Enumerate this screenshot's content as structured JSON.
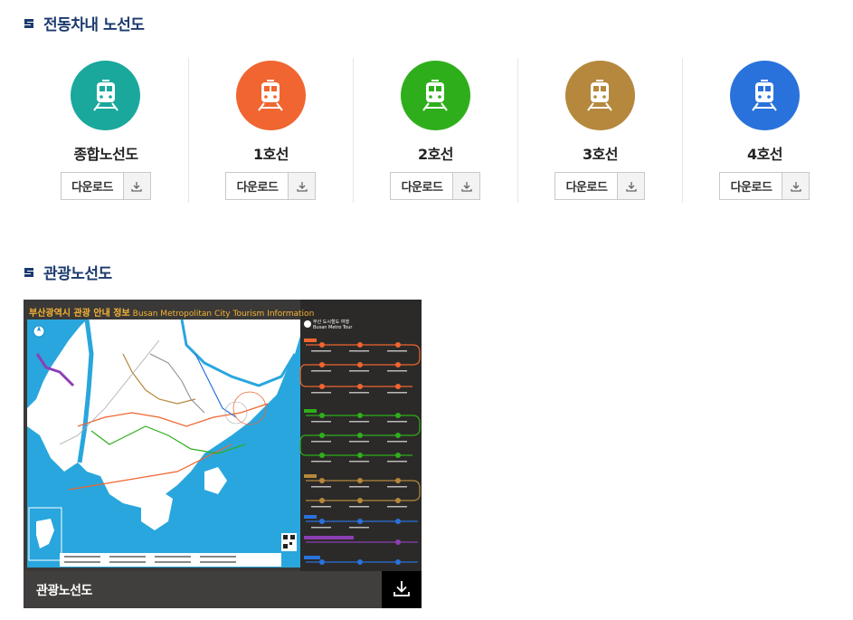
{
  "sections": {
    "onboard": {
      "title": "전동차내 노선도"
    },
    "tourism": {
      "title": "관광노선도"
    }
  },
  "download_label": "다운로드",
  "lines": [
    {
      "name": "종합노선도",
      "color": "#1aa89c"
    },
    {
      "name": "1호선",
      "color": "#f06530"
    },
    {
      "name": "2호선",
      "color": "#2fae1c"
    },
    {
      "name": "3호선",
      "color": "#b5883d"
    },
    {
      "name": "4호선",
      "color": "#2a72db"
    }
  ],
  "tour_map": {
    "title_ko": "부산광역시 관광 안내 정보",
    "title_en": "Busan Metropolitan City Tourism Information",
    "legend_title_ko": "부산 도시철도 여행",
    "legend_title_en": "Busan Metro Tour",
    "caption": "관광노선도"
  },
  "colors": {
    "accent": "#1b3a6e",
    "map_sea": "#29a6dd",
    "map_panel": "#2b2a28"
  }
}
